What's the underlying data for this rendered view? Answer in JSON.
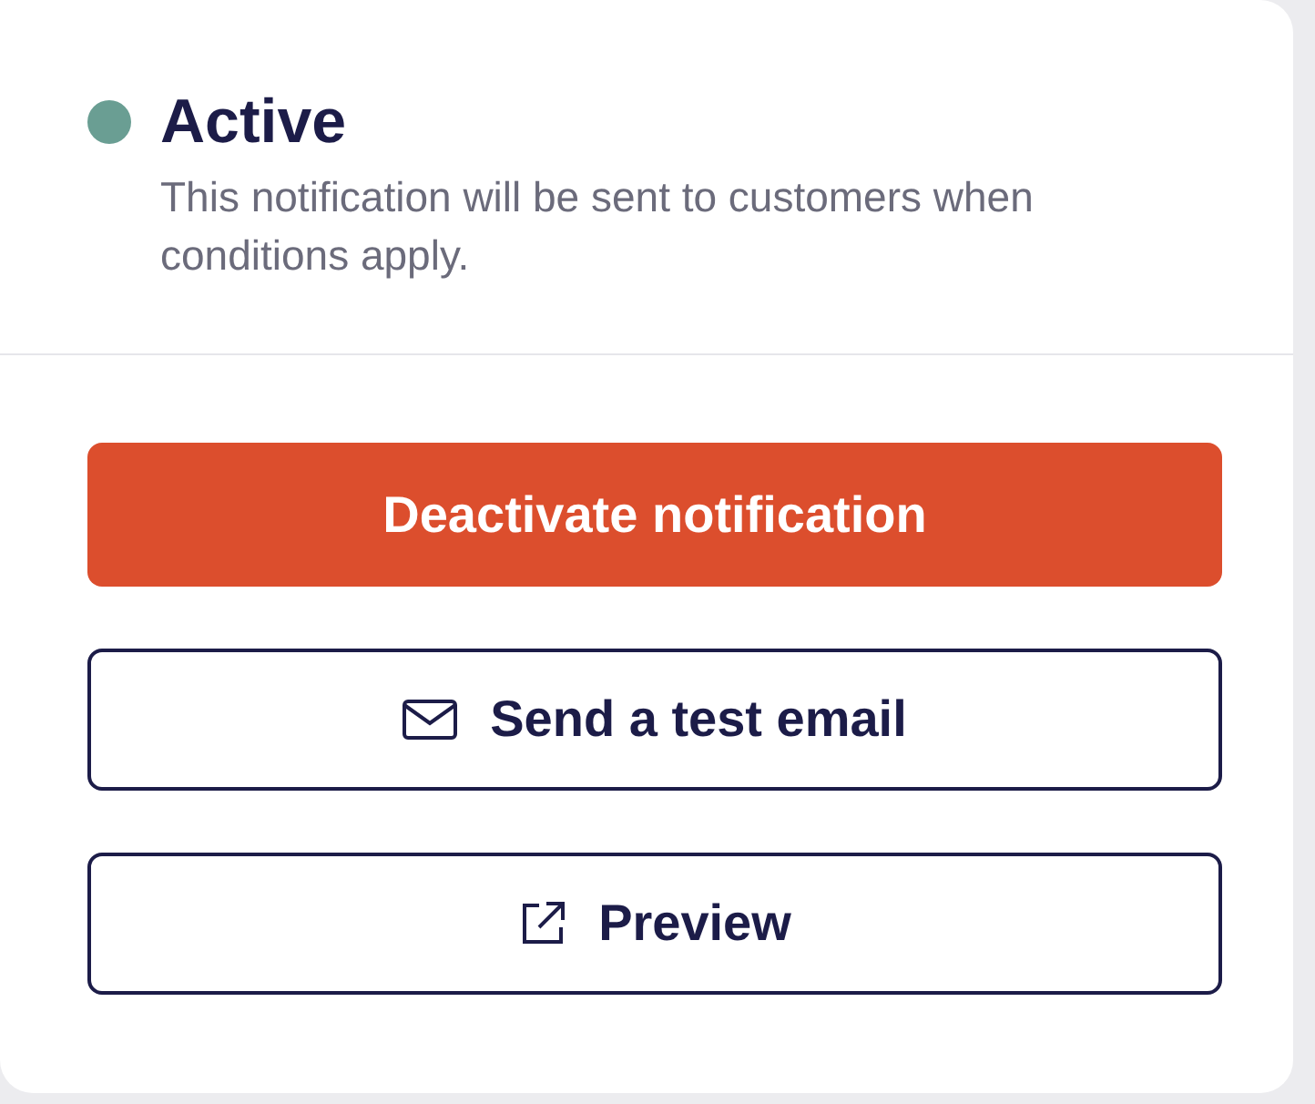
{
  "status": {
    "label": "Active",
    "active": true,
    "description": "This notification will be sent to customers when conditions apply."
  },
  "buttons": [
    {
      "label": "Deactivate notification",
      "kind": "danger"
    },
    {
      "label": "Send a test email",
      "kind": "mail"
    },
    {
      "label": "Preview",
      "kind": "external"
    }
  ]
}
